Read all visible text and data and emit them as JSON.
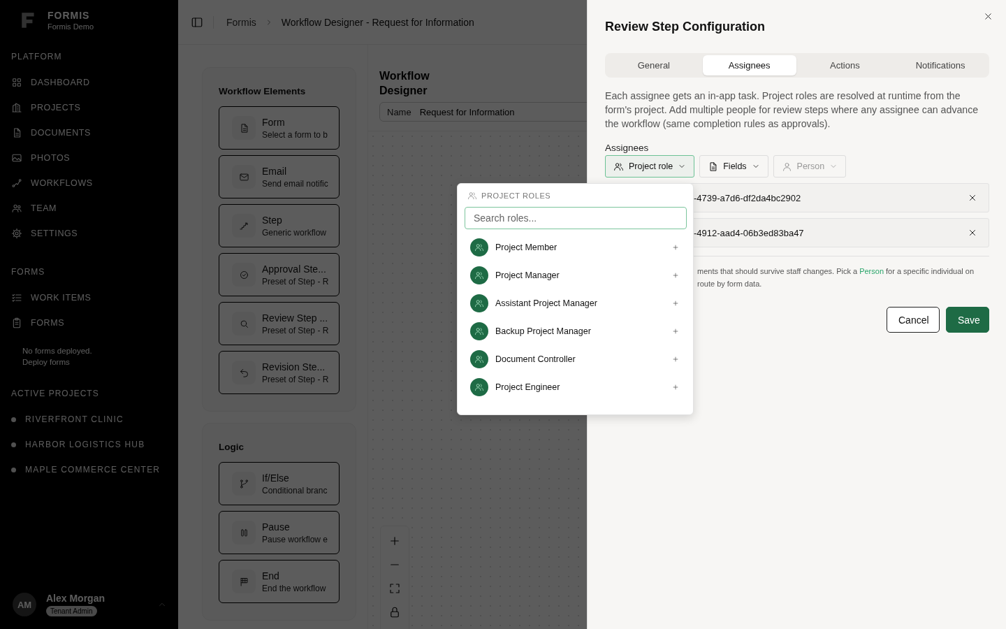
{
  "sidebar": {
    "brand": {
      "name": "FORMIS",
      "subtitle": "Formis Demo"
    },
    "sections": [
      {
        "title": "PLATFORM",
        "items": [
          {
            "label": "DASHBOARD"
          },
          {
            "label": "PROJECTS"
          },
          {
            "label": "DOCUMENTS"
          },
          {
            "label": "PHOTOS"
          },
          {
            "label": "WORKFLOWS"
          },
          {
            "label": "TEAM"
          },
          {
            "label": "SETTINGS"
          }
        ]
      },
      {
        "title": "FORMS",
        "items": [
          {
            "label": "WORK ITEMS"
          },
          {
            "label": "FORMS"
          }
        ],
        "note": [
          "No forms deployed.",
          "Deploy forms"
        ]
      },
      {
        "title": "ACTIVE PROJECTS",
        "projects": [
          {
            "label": "RIVERFRONT CLINIC"
          },
          {
            "label": "HARBOR LOGISTICS HUB"
          },
          {
            "label": "MAPLE COMMERCE CENTER"
          }
        ]
      }
    ],
    "user": {
      "initials": "AM",
      "name": "Alex Morgan",
      "role": "Tenant Admin"
    }
  },
  "breadcrumb": [
    "Formis",
    "Workflow Designer - Request for Information"
  ],
  "palette": [
    {
      "title": "Workflow Elements",
      "items": [
        {
          "title": "Form",
          "description": "Select a form to b"
        },
        {
          "title": "Email",
          "description": "Send email notific"
        },
        {
          "title": "Step",
          "description": "Generic workflow"
        },
        {
          "title": "Approval Ste...",
          "description": "Preset of Step - R"
        },
        {
          "title": "Review Step ...",
          "description": "Preset of Step - R"
        },
        {
          "title": "Revision Ste...",
          "description": "Preset of Step - R"
        }
      ]
    },
    {
      "title": "Logic",
      "items": [
        {
          "title": "If/Else",
          "description": "Conditional branc"
        },
        {
          "title": "Pause",
          "description": "Pause workflow e"
        },
        {
          "title": "End",
          "description": "End the workflow"
        }
      ]
    }
  ],
  "designer": {
    "title": "Workflow Designer",
    "name_label": "Name",
    "name_value": "Request for Information"
  },
  "drawer": {
    "title": "Review Step Configuration",
    "tabs": [
      {
        "label": "General",
        "selected": false
      },
      {
        "label": "Assignees",
        "selected": true
      },
      {
        "label": "Actions",
        "selected": false
      },
      {
        "label": "Notifications",
        "selected": false
      }
    ],
    "description": "Each assignee gets an in-app task. Project roles are resolved at runtime from the form's project. Add multiple people for review steps where any assignee can advance the workflow (same completion rules as approvals).",
    "assignees_label": "Assignees",
    "type_buttons": [
      {
        "label": "Project role",
        "selected": true,
        "disabled": false
      },
      {
        "label": "Fields",
        "selected": false,
        "disabled": false
      },
      {
        "label": "Person",
        "selected": false,
        "disabled": true
      }
    ],
    "assignees": [
      {
        "value": "-4739-a7d6-df2da4bc2902"
      },
      {
        "value": "-4912-aad4-06b3ed83ba47"
      }
    ],
    "help": [
      {
        "before": "ments that should survive staff changes. Pick a ",
        "link": "Person",
        "after": " for a specific individual on"
      },
      {
        "before": "route by form data."
      }
    ],
    "buttons": {
      "cancel": "Cancel",
      "save": "Save"
    }
  },
  "popup": {
    "title": "PROJECT ROLES",
    "search_placeholder": "Search roles...",
    "roles": [
      {
        "name": "Project Member"
      },
      {
        "name": "Project Manager"
      },
      {
        "name": "Assistant Project Manager"
      },
      {
        "name": "Backup Project Manager"
      },
      {
        "name": "Document Controller"
      },
      {
        "name": "Project Engineer"
      }
    ]
  }
}
